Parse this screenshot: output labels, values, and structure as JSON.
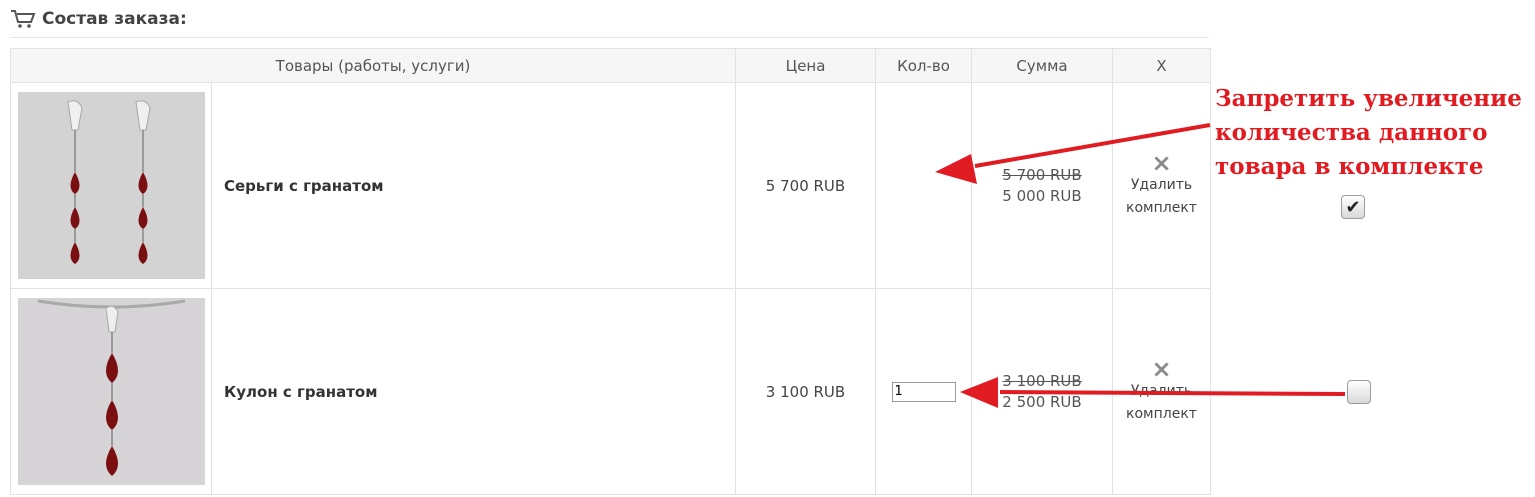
{
  "header": {
    "title": "Состав заказа:"
  },
  "table": {
    "columns": [
      "Товары (работы, услуги)",
      "Цена",
      "Кол-во",
      "Сумма",
      "X"
    ],
    "rows": [
      {
        "name": "Серьги с гранатом",
        "price": "5 700 RUB",
        "quantity": "",
        "old_sum": "5 700 RUB",
        "new_sum": "5 000 RUB",
        "remove_icon": "×",
        "remove_label_1": "Удалить",
        "remove_label_2": "комплект"
      },
      {
        "name": "Кулон с гранатом",
        "price": "3 100 RUB",
        "quantity": "1",
        "old_sum": "3 100 RUB",
        "new_sum": "2 500 RUB",
        "remove_icon": "×",
        "remove_label_1": "Удалить",
        "remove_label_2": "комплект"
      }
    ]
  },
  "annotation": {
    "line1": "Запретить увеличение",
    "line2": "количества данного",
    "line3": "товара в комплекте",
    "color": "#e11b22"
  },
  "checkboxes": [
    {
      "checked": true,
      "mark": "✔"
    },
    {
      "checked": false,
      "mark": ""
    }
  ]
}
